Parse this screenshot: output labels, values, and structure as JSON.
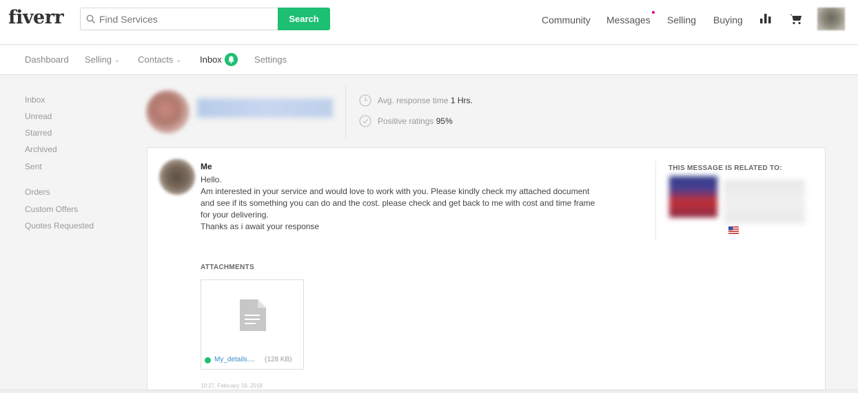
{
  "header": {
    "logo": "fiverr",
    "search": {
      "placeholder": "Find Services",
      "button_label": "Search"
    },
    "nav": {
      "community": "Community",
      "messages": "Messages",
      "selling": "Selling",
      "buying": "Buying"
    },
    "colors": {
      "brand": "#1dbf73",
      "notification_dot": "#e0007a"
    }
  },
  "subnav": {
    "items": [
      {
        "label": "Dashboard"
      },
      {
        "label": "Selling"
      },
      {
        "label": "Contacts"
      },
      {
        "label": "Inbox"
      },
      {
        "label": "Settings"
      }
    ]
  },
  "sidebar": {
    "groups": [
      [
        "Inbox",
        "Unread",
        "Starred",
        "Archived",
        "Sent"
      ],
      [
        "Orders",
        "Custom Offers",
        "Quotes Requested"
      ]
    ]
  },
  "contact": {
    "response_label": "Avg. response time",
    "response_value": "1 Hrs.",
    "ratings_label": "Positive ratings",
    "ratings_value": "95%"
  },
  "message": {
    "sender": "Me",
    "lines": [
      "Hello.",
      "Am interested in your service and would love to work with you. Please kindly check my attached document",
      "and see if its something you can do and the cost. please check and get back to me with cost and time frame",
      "for your delivering.",
      "Thanks as i await your response"
    ],
    "related_title": "THIS MESSAGE IS RELATED TO:",
    "attachments_title": "ATTACHMENTS",
    "attachment": {
      "name": "My_details....",
      "size": "(128 KB)"
    },
    "timestamp": "10:27, February 19, 2018"
  }
}
